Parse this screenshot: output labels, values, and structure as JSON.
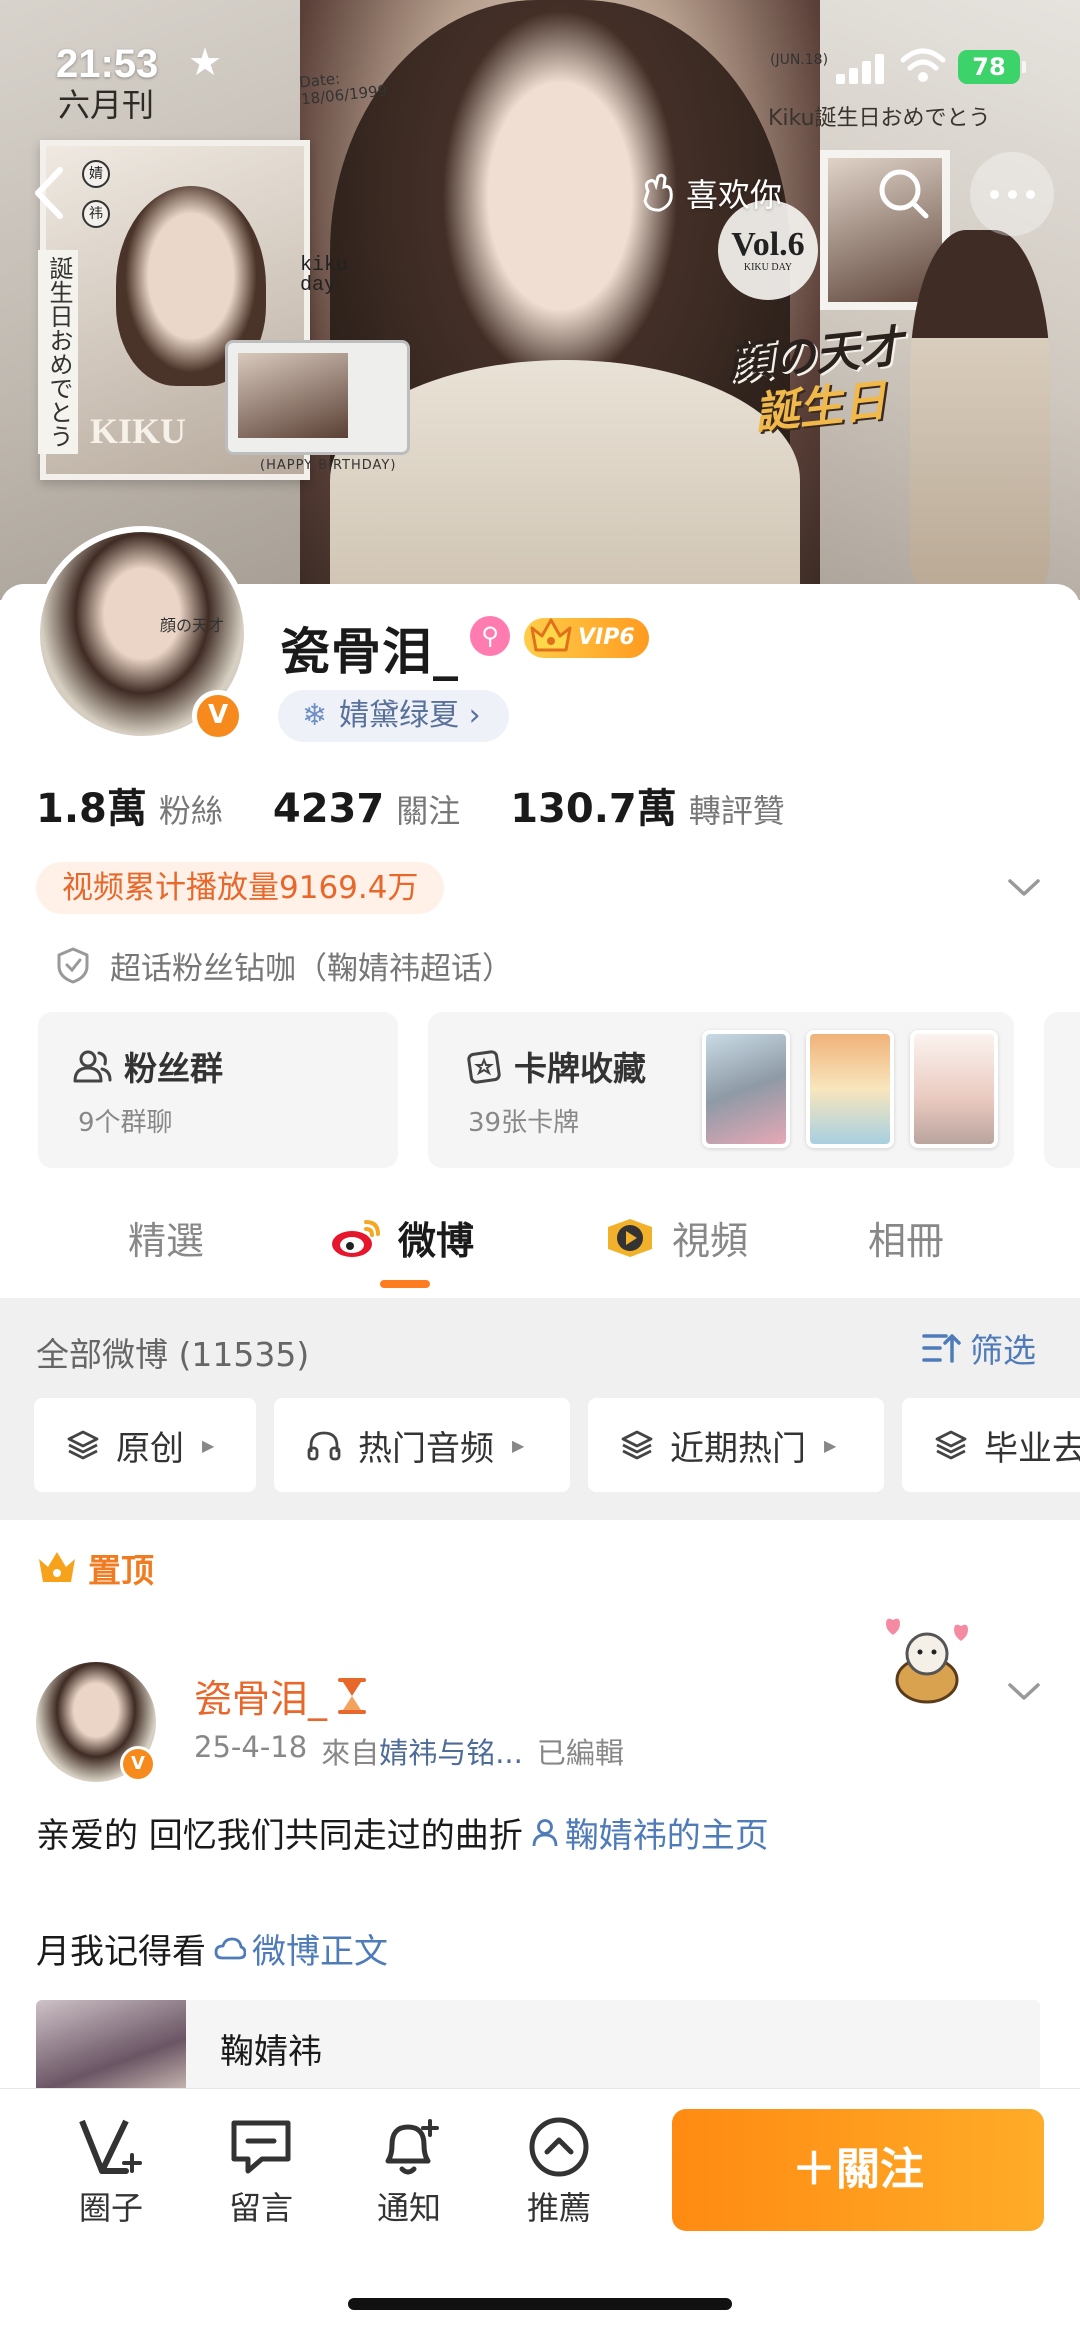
{
  "status_bar": {
    "time": "21:53",
    "battery": "78"
  },
  "banner": {
    "top_note": "六月刊",
    "date_note": "Date:\n18/06/1999",
    "jun_note": "(JUN.18)",
    "jp_note": "Kiku誕生日おめでとう",
    "vertical_text": "誕生日おめでとう",
    "tag1": "婧",
    "tag2": "祎",
    "kiku_label": "KIKU",
    "kiku_day": "kiku\nday",
    "camera_label": "(HAPPY BIRTHDAY)",
    "vol_label": "Vol.6",
    "vol_sub": "KIKU DAY",
    "art_line1": "顔の天才",
    "art_line2": "誕生日"
  },
  "nav": {
    "like_label": "喜欢你"
  },
  "profile": {
    "name": "瓷骨泪_",
    "vip_label": "VIP6",
    "verified_mark": "V",
    "fan_tag": "婧黛绿夏 ›",
    "avatar_text": "顔の天才"
  },
  "stats": [
    {
      "value": "1.8萬",
      "label": "粉絲"
    },
    {
      "value": "4237",
      "label": "關注"
    },
    {
      "value": "130.7萬",
      "label": "轉評贊"
    }
  ],
  "play_count": "视频累计播放量9169.4万",
  "supertopic": "超话粉丝钻咖（鞠婧祎超话）",
  "tiles": {
    "fans_group": {
      "title": "粉丝群",
      "sub": "9个群聊"
    },
    "card_collection": {
      "title": "卡牌收藏",
      "sub": "39张卡牌"
    }
  },
  "tabs": [
    "精選",
    "微博",
    "視頻",
    "相冊"
  ],
  "feed": {
    "count": "全部微博 (11535)",
    "filter": "筛选",
    "chips": [
      "原创",
      "热门音频",
      "近期热门",
      "毕业去"
    ]
  },
  "pinned_label": "置顶",
  "post": {
    "name": "瓷骨泪_",
    "date": "25-4-18",
    "from_prefix": "來自",
    "source": "婧祎与铭...",
    "edited": "已編輯",
    "text1": "亲爱的 回忆我们共同走过的曲折",
    "link1": "鞠婧祎的主页",
    "text2": "月我记得看",
    "link2": "微博正文",
    "embed_title": "鞠婧祎"
  },
  "bottom_bar": {
    "items": [
      "圈子",
      "留言",
      "通知",
      "推薦"
    ],
    "follow": "＋關注"
  },
  "colors": {
    "accent": "#ff8a12",
    "link": "#4f7bb8",
    "name": "#e8672a"
  }
}
